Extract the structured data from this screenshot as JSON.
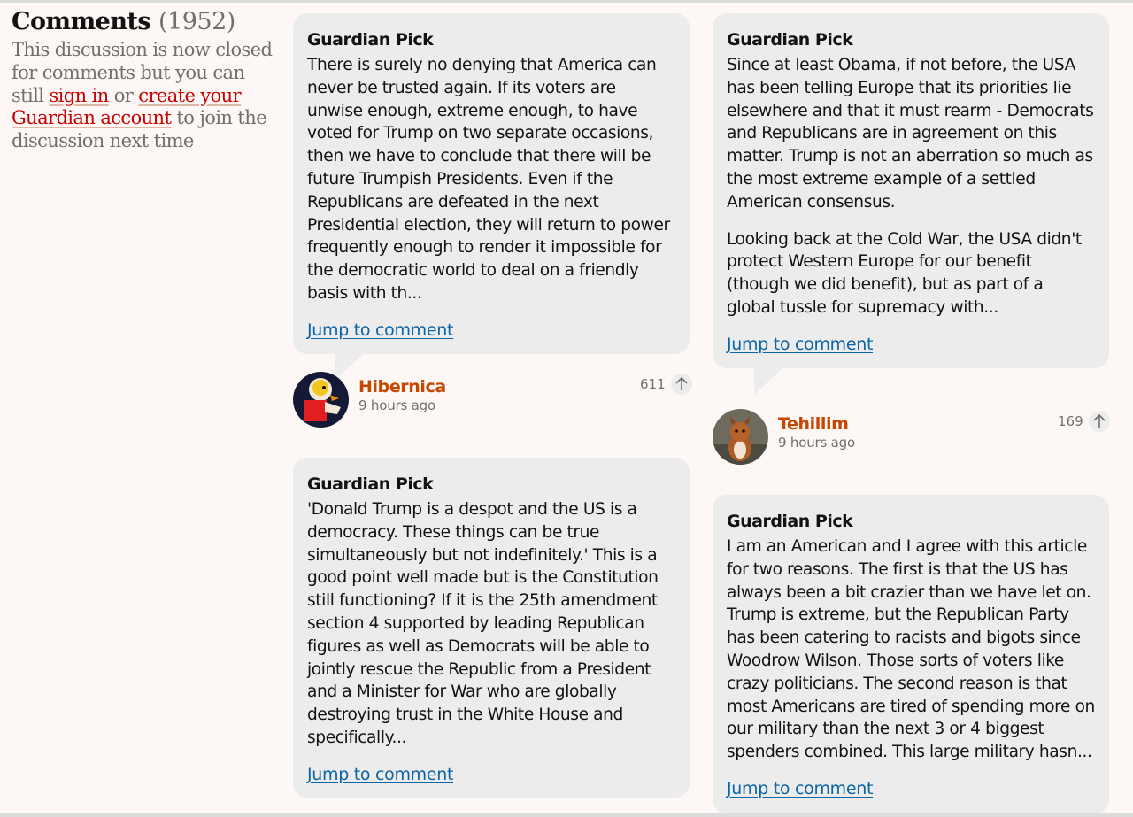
{
  "discussion": {
    "title": "Comments",
    "count": "(1952)",
    "closed_prefix": "This discussion is now closed for comments but you can still",
    "sign_in": "sign in",
    "or": "or",
    "create_account": "create your Guardian account",
    "closed_suffix": "to join the discussion next time"
  },
  "picks": [
    {
      "label": "Guardian Pick",
      "paragraphs": [
        "There is surely no denying that America can never be trusted again. If its voters are unwise enough, extreme enough, to have voted for Trump on two separate occasions, then we have to conclude that there will be future Trumpish Presidents. Even if the Republicans are defeated in the next Presidential election, they will return to power frequently enough to render it impossible for the democratic world to deal on a friendly basis with th..."
      ],
      "jump": "Jump to comment",
      "author": "Hibernica",
      "time": "9 hours ago",
      "recommends": "611",
      "avatar_icon": "bird-cartoon-avatar"
    },
    {
      "label": "Guardian Pick",
      "paragraphs": [
        "Since at least Obama, if not before, the USA has been telling Europe that its priorities lie elsewhere and that it must rearm - Democrats and Republicans are in agreement on this matter. Trump is not an aberration so much as the most extreme example of a settled American consensus.",
        "Looking back at the Cold War, the USA didn't protect Western Europe for our benefit (though we did benefit), but as part of a global tussle for supremacy with..."
      ],
      "jump": "Jump to comment",
      "author": "Tehillim",
      "time": "9 hours ago",
      "recommends": "169",
      "avatar_icon": "squirrel-photo-avatar"
    },
    {
      "label": "Guardian Pick",
      "paragraphs": [
        "'Donald Trump is a despot and the US is a democracy. These things can be true simultaneously but not indefinitely.' This is a good point well made but is the Constitution still functioning? If it is the 25th amendment section 4 supported by leading Republican figures as well as Democrats will be able to jointly rescue the Republic from a President and a Minister for War who are globally destroying trust in the White House and specifically..."
      ],
      "jump": "Jump to comment"
    },
    {
      "label": "Guardian Pick",
      "paragraphs": [
        "I am an American and I agree with this article for two reasons. The first is that the US has always been a bit crazier than we have let on. Trump is extreme, but the Republican Party has been catering to racists and bigots since Woodrow Wilson. Those sorts of voters like crazy politicians. The second reason is that most Americans are tired of spending more on our military than the next 3 or 4 biggest spenders combined. This large military hasn..."
      ],
      "jump": "Jump to comment"
    }
  ],
  "colors": {
    "background": "#fdf8f5",
    "card": "#ececec",
    "author_name": "#c74600",
    "link": "#0a64a8",
    "muted": "#707070",
    "sign_in": "#c70000"
  },
  "icons": {
    "recommend": "arrow-up-icon"
  }
}
